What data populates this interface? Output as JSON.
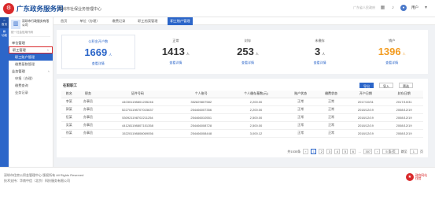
{
  "header": {
    "logo_glyph": "⚙",
    "site_title": "广东政务服务网",
    "center_name": "深圳市社保业务管理中心",
    "right_hint": "广东省人民政府",
    "user_name": "用户"
  },
  "rail": {
    "items": [
      {
        "label": "首页"
      },
      {
        "label": "功能"
      }
    ]
  },
  "sidebar": {
    "org_name": "深圳市行政服务有限公司",
    "org_sub": "统一社会信用代码",
    "menu": [
      {
        "label": "单位管理",
        "kind": "group"
      },
      {
        "label": "职工管理",
        "kind": "open"
      },
      {
        "label": "职工账户管理",
        "kind": "active"
      },
      {
        "label": "缴费基数管理",
        "kind": "sub"
      },
      {
        "label": "业务管理",
        "kind": "group"
      },
      {
        "label": "申报（办理）",
        "kind": "sub"
      },
      {
        "label": "缴费查询",
        "kind": "sub"
      },
      {
        "label": "业务记录",
        "kind": "sub"
      }
    ]
  },
  "tabs": [
    {
      "label": "首页",
      "active": false
    },
    {
      "label": "单位（办理）",
      "active": false
    },
    {
      "label": "缴费记录",
      "active": false
    },
    {
      "label": "职工档案管理",
      "active": false
    },
    {
      "label": "职工账户管理",
      "active": true
    }
  ],
  "stats": [
    {
      "label": "公积金开户数",
      "value": "1669",
      "unit": "人",
      "link": "查看详情"
    },
    {
      "label": "正常",
      "value": "1413",
      "unit": "人",
      "link": "查看详情"
    },
    {
      "label": "封存",
      "value": "253",
      "unit": "人",
      "link": "查看详情"
    },
    {
      "label": "未缴存",
      "value": "3",
      "unit": "人",
      "link": "查看详情"
    },
    {
      "label": "销户",
      "value": "1396",
      "unit": "人",
      "link": "查看详情"
    }
  ],
  "panel": {
    "title": "在职职工",
    "export_label": "导出",
    "import_label": "导入",
    "filter_label": "筛选"
  },
  "table": {
    "columns": [
      "姓名",
      "职务",
      "证件号码",
      "个人账号",
      "个人缴存基数(元)",
      "账户状态",
      "缴费状态",
      "开户日期",
      "封存日期"
    ],
    "rows": [
      [
        "李某",
        "办事员",
        "440301198801235246",
        "352829807582",
        "2,200.00",
        "正常",
        "正常",
        "2017/10/31",
        "2017/10/31"
      ],
      [
        "郭某",
        "办事员",
        "522701198707015637",
        "254466007356",
        "2,200.00",
        "正常",
        "正常",
        "2018/12/19",
        "2008/12/19"
      ],
      [
        "伍某",
        "办事员",
        "530921198702211254",
        "254466010551",
        "2,500.00",
        "正常",
        "正常",
        "2018/12/19",
        "2008/12/19"
      ],
      [
        "吴某",
        "办事员",
        "441281198807151358",
        "254466008728",
        "2,500.00",
        "正常",
        "正常",
        "2018/12/19",
        "2008/12/19"
      ],
      [
        "徐某",
        "办事员",
        "152201198808069056",
        "254466008448",
        "3,000.12",
        "正常",
        "正常",
        "2018/12/19",
        "2008/12/19"
      ]
    ]
  },
  "pagination": {
    "total": "共1535条",
    "prev": "‹",
    "pages": [
      "1",
      "2",
      "3",
      "4",
      "5",
      "6"
    ],
    "ellipsis": "…",
    "last": "307",
    "next": "›",
    "size": "5 条/页",
    "goto_label": "跳至",
    "goto_value": "1",
    "page_unit": "页"
  },
  "footer": {
    "line1": "深圳市住房公积金管理中心 版权所有 All Rights Reserved",
    "line2": "技术支持：华南中信（北京）科技服务有限公司",
    "badge_glyph": "★",
    "badge_line1": "政府网站",
    "badge_line2": "找错"
  },
  "colors": {
    "brand_blue": "#2c66c9",
    "accent_orange": "#f29b1f",
    "seal_red": "#d9292b"
  }
}
